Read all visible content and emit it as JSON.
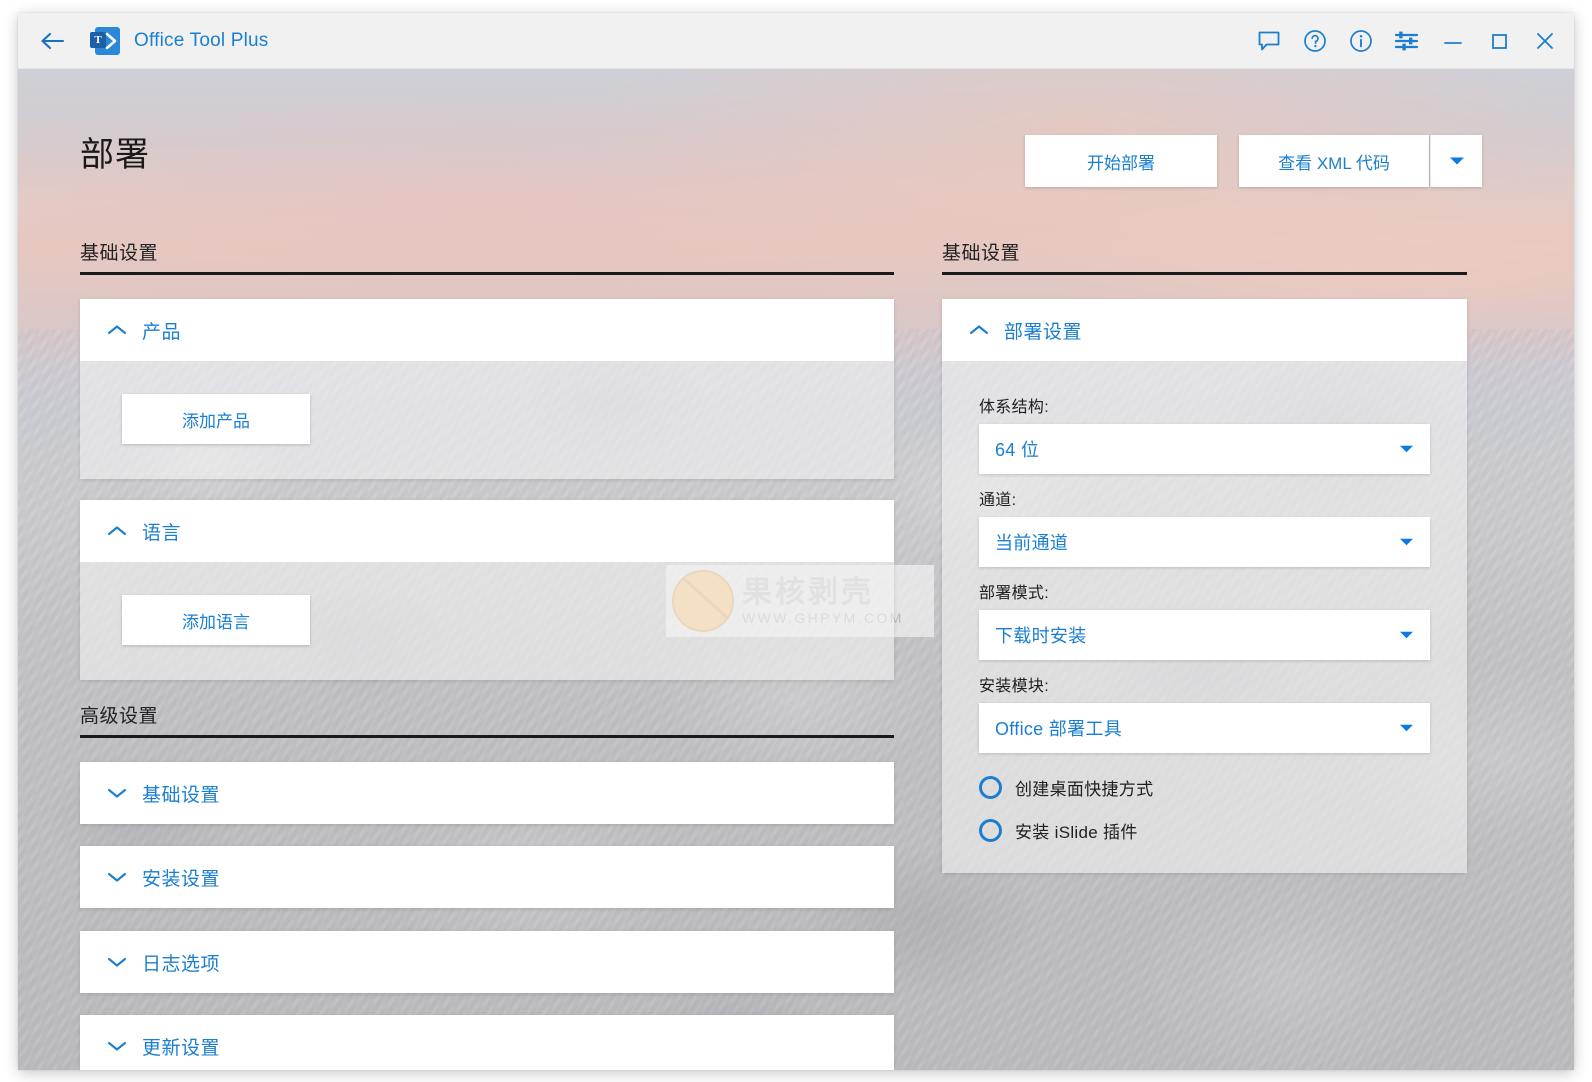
{
  "titlebar": {
    "back_icon": "back-arrow-icon",
    "logo_letter": "T",
    "app_name": "Office Tool Plus",
    "icons": [
      {
        "name": "feedback-icon",
        "label": "feedback"
      },
      {
        "name": "help-icon",
        "label": "help"
      },
      {
        "name": "info-icon",
        "label": "about"
      },
      {
        "name": "settings-sliders-icon",
        "label": "settings"
      },
      {
        "name": "minimize-icon",
        "label": "minimize"
      },
      {
        "name": "maximize-icon",
        "label": "maximize"
      },
      {
        "name": "close-icon",
        "label": "close"
      }
    ]
  },
  "page": {
    "title": "部署",
    "actions": {
      "deploy": "开始部署",
      "view_xml": "查看 XML 代码",
      "split_arrow_icon": "chevron-down-icon"
    }
  },
  "left": {
    "basic_section_label": "基础设置",
    "advanced_section_label": "高级设置",
    "cards": [
      {
        "title": "产品",
        "expanded": true,
        "chevron": "chevron-up-icon",
        "button": "添加产品"
      },
      {
        "title": "语言",
        "expanded": true,
        "chevron": "chevron-up-icon",
        "button": "添加语言"
      }
    ],
    "advanced_cards": [
      {
        "title": "基础设置",
        "chevron": "chevron-down-icon"
      },
      {
        "title": "安装设置",
        "chevron": "chevron-down-icon"
      },
      {
        "title": "日志选项",
        "chevron": "chevron-down-icon"
      },
      {
        "title": "更新设置",
        "chevron": "chevron-down-icon"
      }
    ]
  },
  "right": {
    "section_label": "基础设置",
    "card_title": "部署设置",
    "card_chevron": "chevron-up-icon",
    "fields": [
      {
        "label": "体系结构:",
        "value": "64 位",
        "arrow": "chevron-down-icon"
      },
      {
        "label": "通道:",
        "value": "当前通道",
        "arrow": "chevron-down-icon"
      },
      {
        "label": "部署模式:",
        "value": "下载时安装",
        "arrow": "chevron-down-icon"
      },
      {
        "label": "安装模块:",
        "value": "Office 部署工具",
        "arrow": "chevron-down-icon"
      }
    ],
    "toggles": [
      {
        "label": "创建桌面快捷方式",
        "checked": false
      },
      {
        "label": "安装 iSlide 插件",
        "checked": false
      }
    ]
  },
  "watermark": {
    "cn": "果核剥壳",
    "url": "WWW.GHPYM.COM"
  },
  "colors": {
    "accent": "#1b7fd1",
    "titlebar_bg": "#f1f1f1",
    "card_bg": "#ffffff",
    "rule": "#1a1a1a"
  }
}
